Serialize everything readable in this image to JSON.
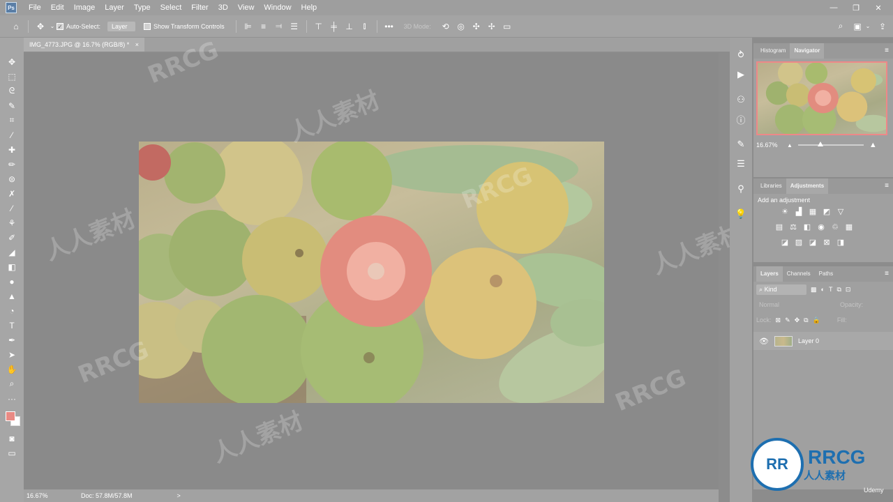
{
  "app": {
    "logo": "Ps"
  },
  "menu": [
    "File",
    "Edit",
    "Image",
    "Layer",
    "Type",
    "Select",
    "Filter",
    "3D",
    "View",
    "Window",
    "Help"
  ],
  "options_bar": {
    "auto_select_label": "Auto-Select:",
    "layer_select": "Layer",
    "show_transform_label": "Show Transform Controls",
    "mode_3d_label": "3D Mode:"
  },
  "document": {
    "tab_title": "IMG_4773.JPG @ 16.7% (RGB/8) *",
    "close_glyph": "×"
  },
  "status": {
    "zoom": "16.67%",
    "doc_info": "Doc: 57.8M/57.8M",
    "arrow": ">"
  },
  "navigator_panel": {
    "tabs": [
      "Histogram",
      "Navigator"
    ],
    "active_tab": "Navigator",
    "zoom": "16.67%"
  },
  "adjustments_panel": {
    "tabs": [
      "Libraries",
      "Adjustments"
    ],
    "active_tab": "Adjustments",
    "heading": "Add an adjustment"
  },
  "layers_panel": {
    "tabs": [
      "Layers",
      "Channels",
      "Paths"
    ],
    "active_tab": "Layers",
    "filter_kind": "Kind",
    "blend_mode": "Normal",
    "opacity_label": "Opacity:",
    "lock_label": "Lock:",
    "fill_label": "Fill:",
    "layers": [
      {
        "name": "Layer 0",
        "visible": true
      }
    ]
  },
  "watermarks": [
    "RRCG",
    "人人素材",
    "RRCG",
    "人人素材",
    "RRCG",
    "人人素材",
    "RRCG",
    "人人素材"
  ],
  "branding": {
    "rrcg": "RRCG",
    "rrcg_cn": "人人素材",
    "udemy": "Udemy"
  },
  "colors": {
    "foreground": "#e98a84",
    "background": "#ffffff",
    "nav_frame": "#ee8888",
    "brand_blue": "#1e6fb0"
  }
}
